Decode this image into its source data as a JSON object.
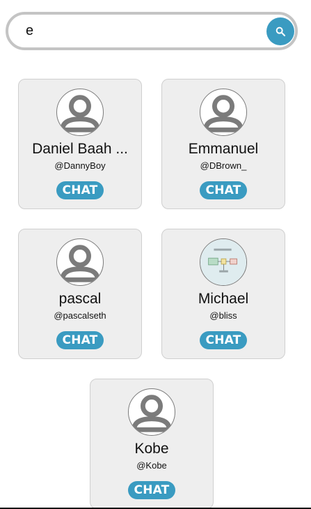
{
  "search": {
    "value": "e",
    "button_icon": "search-icon"
  },
  "colors": {
    "accent": "#3a9bc1",
    "card_background": "#eeeeee",
    "search_border": "#c4c4c4"
  },
  "users": [
    {
      "name": "Daniel Baah ...",
      "handle": "@DannyBoy",
      "avatar": "default-avatar-icon",
      "chat_label": "CHAT"
    },
    {
      "name": "Emmanuel",
      "handle": "@DBrown_",
      "avatar": "default-avatar-icon",
      "chat_label": "CHAT"
    },
    {
      "name": "pascal",
      "handle": "@pascalseth",
      "avatar": "default-avatar-icon",
      "chat_label": "CHAT"
    },
    {
      "name": "Michael",
      "handle": "@bliss",
      "avatar": "diagram-photo",
      "chat_label": "CHAT"
    },
    {
      "name": "Kobe",
      "handle": "@Kobe",
      "avatar": "default-avatar-icon",
      "chat_label": "CHAT"
    }
  ]
}
